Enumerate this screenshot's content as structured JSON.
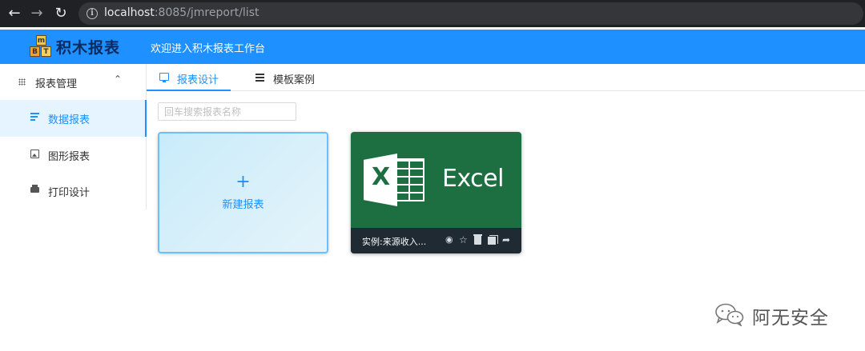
{
  "browser": {
    "url_host": "localhost",
    "url_rest": ":8085/jmreport/list"
  },
  "header": {
    "logo_blocks": [
      "m",
      "B",
      "T"
    ],
    "app_name": "积木报表",
    "welcome": "欢迎进入积木报表工作台"
  },
  "sidebar": {
    "group_label": "报表管理",
    "items": [
      {
        "label": "数据报表",
        "icon": "lines-icon",
        "active": true
      },
      {
        "label": "图形报表",
        "icon": "image-icon",
        "active": false
      },
      {
        "label": "打印设计",
        "icon": "printer-icon",
        "active": false
      }
    ]
  },
  "tabs": [
    {
      "label": "报表设计",
      "icon": "monitor-icon",
      "active": true
    },
    {
      "label": "模板案例",
      "icon": "sliders-icon",
      "active": false
    }
  ],
  "search": {
    "placeholder": "回车搜索报表名称",
    "value": ""
  },
  "new_card": {
    "plus": "+",
    "label": "新建报表"
  },
  "template_card": {
    "thumbnail_letter": "X",
    "thumbnail_word": "Excel",
    "name": "实例:来源收入...",
    "actions": [
      "eye-icon",
      "star-icon",
      "trash-icon",
      "copy-icon",
      "share-icon"
    ]
  },
  "watermark": {
    "text": "阿无安全"
  },
  "colors": {
    "brand_blue": "#1e90ff",
    "excel_green": "#1d6f42",
    "card_footer": "#1f2a33"
  }
}
